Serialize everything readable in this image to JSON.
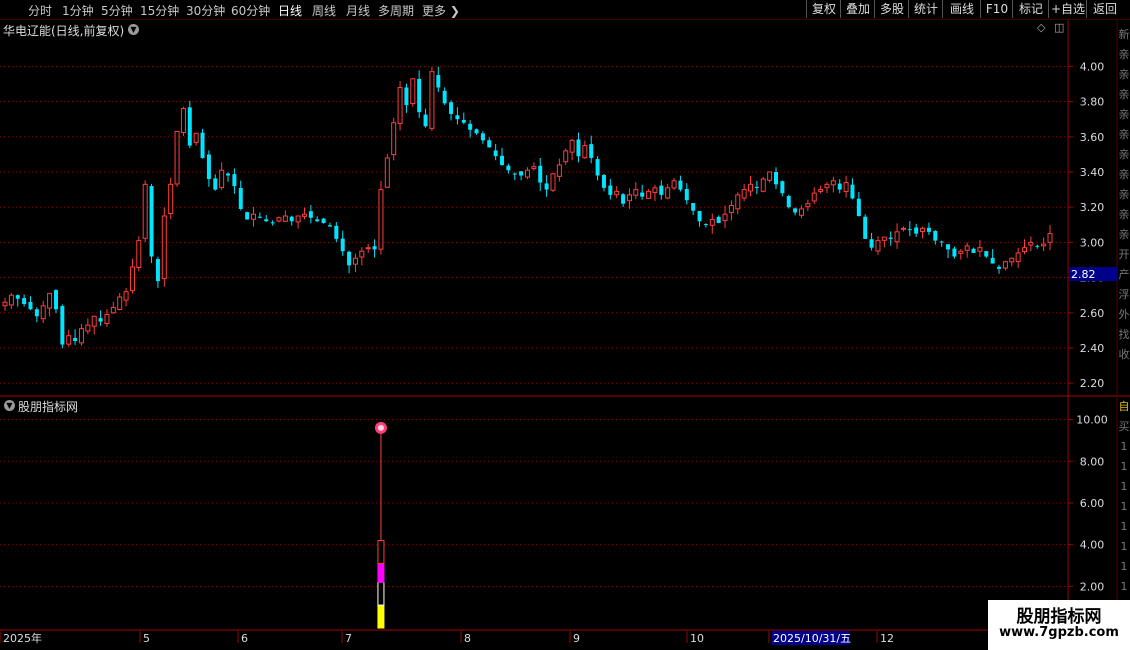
{
  "toolbar": {
    "periods": [
      "分时",
      "1分钟",
      "5分钟",
      "15分钟",
      "30分钟",
      "60分钟",
      "日线",
      "周线",
      "月线",
      "多周期",
      "更多"
    ],
    "active_period": "日线",
    "buttons": [
      "复权",
      "叠加",
      "多股",
      "统计",
      "画线",
      "F10",
      "标记",
      "+自选",
      "返回"
    ]
  },
  "main_panel": {
    "title": "华电辽能(日线,前复权)",
    "current_price_label": "2.82",
    "right_side_text": [
      "新",
      "亲",
      "亲",
      "亲",
      "亲",
      "亲",
      "亲",
      "亲",
      "亲",
      "亲",
      "亲",
      "开",
      "产",
      "浮",
      "外",
      "找",
      "收"
    ]
  },
  "indicator_panel": {
    "title": "股朋指标网",
    "right_side_text": [
      "自",
      "买",
      "1",
      "1",
      "1",
      "1",
      "1",
      "1",
      "1",
      "1"
    ]
  },
  "date_axis": {
    "labels": [
      "2025年",
      "5",
      "6",
      "7",
      "8",
      "9",
      "10",
      "2025/10/31/五",
      "12"
    ]
  },
  "watermark": {
    "title": "股朋指标网",
    "url": "www.7gpzb.com"
  },
  "colors": {
    "up": "#ff3d3d",
    "down": "#00e5ff",
    "grid": "#8b0000",
    "axis_text": "#dcdcdc",
    "price_label_bg": "#00008b",
    "signal_top": "#ff3d3d",
    "signal_mid": "#ff00ff",
    "signal_bottom": "#ffff00"
  },
  "chart_data": [
    {
      "type": "candlestick",
      "ylim": [
        2.15,
        4.15
      ],
      "yticks": [
        "4.00",
        "3.80",
        "3.60",
        "3.40",
        "3.20",
        "3.00",
        "2.80",
        "2.60",
        "2.40",
        "2.20"
      ],
      "ytick_values": [
        4.0,
        3.8,
        3.6,
        3.4,
        3.2,
        3.0,
        2.8,
        2.6,
        2.4,
        2.2
      ],
      "last_price": 2.82,
      "closes": [
        2.66,
        2.7,
        2.68,
        2.65,
        2.62,
        2.58,
        2.64,
        2.71,
        2.62,
        2.42,
        2.47,
        2.44,
        2.51,
        2.53,
        2.58,
        2.55,
        2.59,
        2.63,
        2.69,
        2.72,
        2.86,
        3.01,
        3.33,
        2.92,
        2.78,
        3.15,
        3.33,
        3.63,
        3.76,
        3.55,
        3.62,
        3.48,
        3.36,
        3.3,
        3.41,
        3.38,
        3.32,
        3.19,
        3.13,
        3.16,
        3.14,
        3.12,
        3.11,
        3.14,
        3.15,
        3.12,
        3.15,
        3.16,
        3.14,
        3.12,
        3.11,
        3.09,
        3.02,
        2.95,
        2.87,
        2.91,
        2.95,
        2.97,
        2.96,
        3.3,
        3.48,
        3.68,
        3.88,
        3.78,
        3.93,
        3.74,
        3.66,
        3.97,
        3.88,
        3.79,
        3.73,
        3.7,
        3.68,
        3.64,
        3.62,
        3.58,
        3.54,
        3.49,
        3.44,
        3.41,
        3.39,
        3.38,
        3.41,
        3.43,
        3.34,
        3.3,
        3.39,
        3.44,
        3.52,
        3.58,
        3.49,
        3.55,
        3.48,
        3.38,
        3.31,
        3.27,
        3.29,
        3.22,
        3.27,
        3.3,
        3.26,
        3.29,
        3.31,
        3.27,
        3.31,
        3.35,
        3.3,
        3.24,
        3.18,
        3.12,
        3.1,
        3.13,
        3.11,
        3.16,
        3.21,
        3.27,
        3.3,
        3.33,
        3.31,
        3.36,
        3.4,
        3.33,
        3.28,
        3.2,
        3.17,
        3.19,
        3.22,
        3.28,
        3.3,
        3.33,
        3.35,
        3.3,
        3.34,
        3.25,
        3.15,
        3.02,
        2.97,
        3.01,
        3.03,
        3.02,
        3.06,
        3.08,
        3.07,
        3.05,
        3.08,
        3.06,
        3.01,
        3.0,
        2.96,
        2.92,
        2.95,
        2.98,
        2.94,
        2.97,
        2.92,
        2.88,
        2.85,
        2.89,
        2.91,
        2.94,
        2.97,
        3.0,
        2.98,
        2.99,
        3.05
      ]
    },
    {
      "type": "bar",
      "ylim": [
        0,
        10.7
      ],
      "yticks": [
        "10.00",
        "8.00",
        "6.00",
        "4.00",
        "2.00"
      ],
      "ytick_values": [
        10,
        8,
        6,
        4,
        2
      ],
      "signal_index": 59,
      "signal_line_value": 9.6,
      "segments": [
        {
          "from": 0,
          "to": 1.1,
          "color": "yellow"
        },
        {
          "from": 1.1,
          "to": 2.2,
          "color": "white"
        },
        {
          "from": 2.2,
          "to": 3.1,
          "color": "magenta"
        },
        {
          "from": 3.1,
          "to": 4.2,
          "color": "red"
        }
      ]
    }
  ]
}
